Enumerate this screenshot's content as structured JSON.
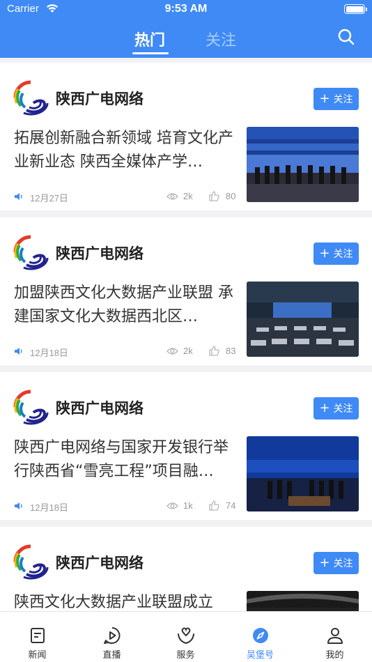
{
  "status_bar": {
    "carrier": "Carrier",
    "time": "9:53 AM"
  },
  "header": {
    "tabs": [
      {
        "label": "热门",
        "active": true
      },
      {
        "label": "关注",
        "active": false
      }
    ],
    "search_icon": "search-icon"
  },
  "feed": [
    {
      "source": "陕西广电网络",
      "follow_label": "关注",
      "title": "拓展创新融合新领域 培育文化产业新业态 陕西全媒体产学…",
      "date": "12月27日",
      "views": "2k",
      "likes": "80"
    },
    {
      "source": "陕西广电网络",
      "follow_label": "关注",
      "title": "加盟陕西文化大数据产业联盟 承建国家文化大数据西北区…",
      "date": "12月18日",
      "views": "2k",
      "likes": "83"
    },
    {
      "source": "陕西广电网络",
      "follow_label": "关注",
      "title": "陕西广电网络与国家开发银行举行陕西省“雪亮工程”项目融…",
      "date": "12月18日",
      "views": "1k",
      "likes": "74"
    },
    {
      "source": "陕西广电网络",
      "follow_label": "关注",
      "title": "陕西文化大数据产业联盟成立",
      "date": "",
      "views": "",
      "likes": ""
    }
  ],
  "tabbar": [
    {
      "label": "新闻",
      "icon": "news-icon",
      "active": false
    },
    {
      "label": "直播",
      "icon": "live-play-icon",
      "active": false
    },
    {
      "label": "服务",
      "icon": "service-heart-icon",
      "active": false
    },
    {
      "label": "吴堡号",
      "icon": "compass-icon",
      "active": true
    },
    {
      "label": "我的",
      "icon": "profile-icon",
      "active": false
    }
  ],
  "colors": {
    "brand_blue": "#3f8af5",
    "inactive_tab": "#a8cdfb"
  }
}
